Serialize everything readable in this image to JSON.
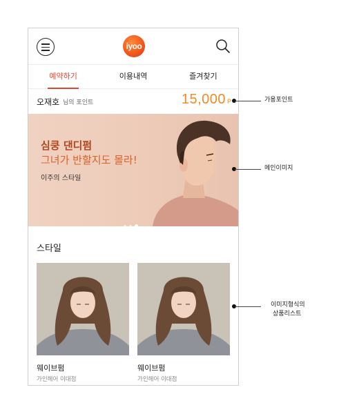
{
  "header": {
    "logo_text": "iyoo",
    "brand_color": "#f25a1a",
    "menu_icon": "menu-icon",
    "search_icon": "search-icon"
  },
  "tabs": [
    {
      "label": "예약하기",
      "active": true
    },
    {
      "label": "이용내역",
      "active": false
    },
    {
      "label": "즐겨찾기",
      "active": false
    }
  ],
  "points": {
    "user_name": "오재호",
    "suffix": "님의 포인트",
    "value": "15,000",
    "unit": "P",
    "color": "#f08a24"
  },
  "banner": {
    "line1": "심쿵 댄디펌",
    "line2": "그녀가 반할지도 몰라!",
    "subtitle": "이주의 스타일",
    "slide_count": 3,
    "active_slide": 3
  },
  "style_section": {
    "title": "스타일",
    "items": [
      {
        "name": "웨이브펌",
        "shop": "가인헤어 이대점"
      },
      {
        "name": "웨이브펌",
        "shop": "가인헤어 이대점"
      }
    ]
  },
  "annotations": {
    "points_label": "가용포인트",
    "main_image_label": "메인이미지",
    "list_label_line1": "이미지형식의",
    "list_label_line2": "상품리스트"
  }
}
